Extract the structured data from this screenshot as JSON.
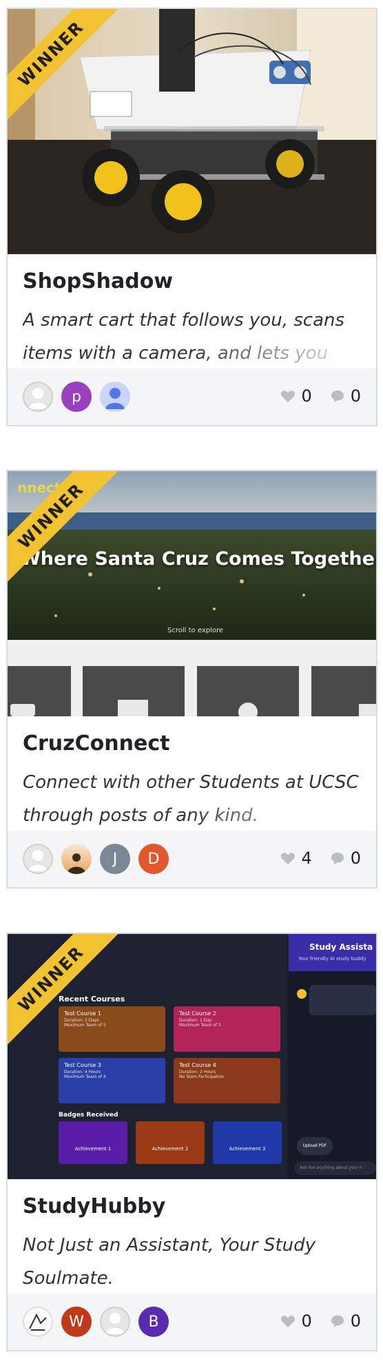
{
  "ribbon_label": "WINNER",
  "cards": [
    {
      "title": "ShopShadow",
      "description": "A smart cart that follows you, scans items with a camera, and lets you",
      "likes": "0",
      "comments": "0",
      "avatars": [
        {
          "kind": "blank",
          "letter": ""
        },
        {
          "kind": "letter",
          "letter": "p",
          "color": "#9a3fbf"
        },
        {
          "kind": "person",
          "letter": "",
          "color": "#6c8cf0"
        }
      ]
    },
    {
      "title": "CruzConnect",
      "description": "Connect with other Students at UCSC through posts of any kind.",
      "likes": "4",
      "comments": "0",
      "thumb": {
        "brand": "nnect",
        "headline": "Where Santa Cruz Comes Together",
        "hint": "Scroll to explore"
      },
      "avatars": [
        {
          "kind": "blank",
          "letter": ""
        },
        {
          "kind": "photo",
          "letter": ""
        },
        {
          "kind": "letter",
          "letter": "J",
          "color": "#7b8794"
        },
        {
          "kind": "letter",
          "letter": "D",
          "color": "#e2572b"
        }
      ]
    },
    {
      "title": "StudyHubby",
      "description": "Not Just an Assistant, Your Study Soulmate.",
      "likes": "0",
      "comments": "0",
      "thumb": {
        "chat_title": "Study Assista",
        "chat_sub": "Your friendly AI study buddy",
        "recent": "Recent Courses",
        "badges": "Badges Received",
        "courses": [
          {
            "name": "Test Course 1",
            "meta": "Duration: 2 Days",
            "meta2": "Maximum Team of 5",
            "color": "#8a4b1c"
          },
          {
            "name": "Test Course 2",
            "meta": "Duration: 1 Day",
            "meta2": "Maximum Team of 3",
            "color": "#b3245a"
          },
          {
            "name": "Test Course 3",
            "meta": "Duration: 4 Hours",
            "meta2": "Maximum Team of 4",
            "color": "#2a3fa8"
          },
          {
            "name": "Test Course 4",
            "meta": "Duration: 2 Hours",
            "meta2": "No Team Participation",
            "color": "#8a3a1a"
          }
        ],
        "achievements": [
          {
            "name": "Achievement 1",
            "color": "#5a1ea8"
          },
          {
            "name": "Achievement 2",
            "color": "#9a3a14"
          },
          {
            "name": "Achievement 3",
            "color": "#1f3aa8"
          }
        ],
        "upload": "Upload PDF",
        "ask": "Ask me anything about your n"
      },
      "avatars": [
        {
          "kind": "sketch",
          "letter": ""
        },
        {
          "kind": "letter",
          "letter": "W",
          "color": "#c03a1a"
        },
        {
          "kind": "blank",
          "letter": ""
        },
        {
          "kind": "letter",
          "letter": "B",
          "color": "#5a2ab0"
        }
      ]
    }
  ]
}
